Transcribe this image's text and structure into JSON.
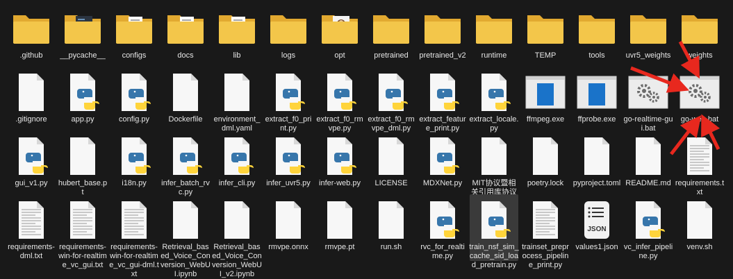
{
  "files": [
    {
      "name": ".github",
      "type": "folder"
    },
    {
      "name": "__pycache__",
      "type": "folder-code"
    },
    {
      "name": "configs",
      "type": "folder-doc"
    },
    {
      "name": "docs",
      "type": "folder-doc"
    },
    {
      "name": "lib",
      "type": "folder-doc"
    },
    {
      "name": "logs",
      "type": "folder"
    },
    {
      "name": "opt",
      "type": "folder-img"
    },
    {
      "name": "pretrained",
      "type": "folder"
    },
    {
      "name": "pretrained_v2",
      "type": "folder"
    },
    {
      "name": "runtime",
      "type": "folder"
    },
    {
      "name": "TEMP",
      "type": "folder"
    },
    {
      "name": "tools",
      "type": "folder"
    },
    {
      "name": "uvr5_weights",
      "type": "folder"
    },
    {
      "name": "weights",
      "type": "folder"
    },
    {
      "name": ".gitignore",
      "type": "file"
    },
    {
      "name": "app.py",
      "type": "python"
    },
    {
      "name": "config.py",
      "type": "python"
    },
    {
      "name": "Dockerfile",
      "type": "file"
    },
    {
      "name": "environment_dml.yaml",
      "type": "file"
    },
    {
      "name": "extract_f0_print.py",
      "type": "python"
    },
    {
      "name": "extract_f0_rmvpe.py",
      "type": "python"
    },
    {
      "name": "extract_f0_rmvpe_dml.py",
      "type": "python"
    },
    {
      "name": "extract_feature_print.py",
      "type": "python"
    },
    {
      "name": "extract_locale.py",
      "type": "python"
    },
    {
      "name": "ffmpeg.exe",
      "type": "exe"
    },
    {
      "name": "ffprobe.exe",
      "type": "exe"
    },
    {
      "name": "go-realtime-gui.bat",
      "type": "bat"
    },
    {
      "name": "go-web.bat",
      "type": "bat"
    },
    {
      "name": "gui_v1.py",
      "type": "python"
    },
    {
      "name": "hubert_base.pt",
      "type": "file"
    },
    {
      "name": "i18n.py",
      "type": "python"
    },
    {
      "name": "infer_batch_rvc.py",
      "type": "python"
    },
    {
      "name": "infer_cli.py",
      "type": "python"
    },
    {
      "name": "infer_uvr5.py",
      "type": "python"
    },
    {
      "name": "infer-web.py",
      "type": "python"
    },
    {
      "name": "LICENSE",
      "type": "file"
    },
    {
      "name": "MDXNet.py",
      "type": "python"
    },
    {
      "name": "MIT协议暨相关引用库协议",
      "type": "file"
    },
    {
      "name": "poetry.lock",
      "type": "file"
    },
    {
      "name": "pyproject.toml",
      "type": "file"
    },
    {
      "name": "README.md",
      "type": "file"
    },
    {
      "name": "requirements.txt",
      "type": "text"
    },
    {
      "name": "requirements-dml.txt",
      "type": "text"
    },
    {
      "name": "requirements-win-for-realtime_vc_gui.txt",
      "type": "text"
    },
    {
      "name": "requirements-win-for-realtime_vc_gui-dml.txt",
      "type": "text"
    },
    {
      "name": "Retrieval_based_Voice_Conversion_WebUI.ipynb",
      "type": "file"
    },
    {
      "name": "Retrieval_based_Voice_Conversion_WebUI_v2.ipynb",
      "type": "file"
    },
    {
      "name": "rmvpe.onnx",
      "type": "file"
    },
    {
      "name": "rmvpe.pt",
      "type": "file"
    },
    {
      "name": "run.sh",
      "type": "file"
    },
    {
      "name": "rvc_for_realtime.py",
      "type": "python"
    },
    {
      "name": "train_nsf_sim_cache_sid_load_pretrain.py",
      "type": "python",
      "selected": true
    },
    {
      "name": "trainset_preprocess_pipeline_print.py",
      "type": "text"
    },
    {
      "name": "values1.json",
      "type": "json"
    },
    {
      "name": "vc_infer_pipeline.py",
      "type": "python"
    },
    {
      "name": "venv.sh",
      "type": "file"
    }
  ],
  "colors": {
    "background": "#191919",
    "folder": "#f3c64a",
    "folder_back": "#e2a930",
    "arrow": "#e8281e",
    "label": "#e6e6e6"
  }
}
